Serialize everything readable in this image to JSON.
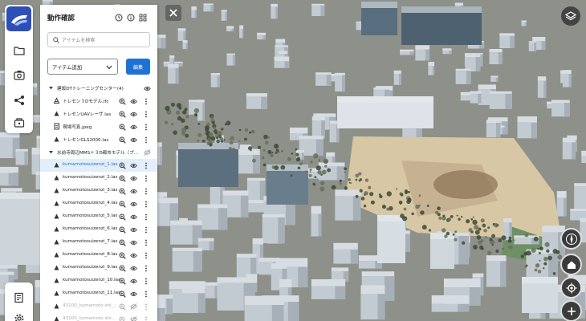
{
  "panel": {
    "title": "動作確認",
    "search_placeholder": "アイテムを検索",
    "select_value": "アイテム追加",
    "edit_label": "編集"
  },
  "tree": [
    {
      "label": "建設DTトレーニングセンター(4)",
      "level": 0,
      "type": "folder",
      "eye": true
    },
    {
      "label": "トレセン３Dモデル.ifc",
      "level": 1,
      "type": "model"
    },
    {
      "label": "トレセンUAVレーザ.las",
      "level": 1,
      "type": "points"
    },
    {
      "label": "現場写真.jpeg",
      "level": 1,
      "type": "doc"
    },
    {
      "label": "トレセンGLS2000.las",
      "level": 1,
      "type": "points"
    },
    {
      "label": "水前寺周辺MMS＋３D都市モデル（プ...",
      "level": 0,
      "type": "folder",
      "eye": false
    },
    {
      "label": "kumamotosuizenzi_1.las",
      "level": 1,
      "type": "points",
      "selected": true
    },
    {
      "label": "kumamotosuizenzi_2.las",
      "level": 1,
      "type": "points"
    },
    {
      "label": "kumamotosuizenzi_3.las",
      "level": 1,
      "type": "points"
    },
    {
      "label": "kumamotosuizenzi_4.las",
      "level": 1,
      "type": "points"
    },
    {
      "label": "kumamotosuizenzi_5.las",
      "level": 1,
      "type": "points"
    },
    {
      "label": "kumamotosuizenzi_6.las",
      "level": 1,
      "type": "points"
    },
    {
      "label": "kumamotosuizenzi_7.las",
      "level": 1,
      "type": "points"
    },
    {
      "label": "kumamotosuizenzi_8.las",
      "level": 1,
      "type": "points"
    },
    {
      "label": "kumamotosuizenzi_9.las",
      "level": 1,
      "type": "points"
    },
    {
      "label": "kumamotosuizenzi_10.las",
      "level": 1,
      "type": "points"
    },
    {
      "label": "kumamotosuizenzi_11.las",
      "level": 1,
      "type": "points"
    },
    {
      "label": "43100_kumamoto-shi_...",
      "level": 1,
      "type": "points",
      "faded": true
    },
    {
      "label": "43100_kumamoto-shi...",
      "level": 1,
      "type": "points",
      "faded": true
    }
  ],
  "colors": {
    "accent": "#1e73d2",
    "selected_bg": "#e3eefb",
    "logo": "#2d4fb6"
  },
  "icons": {
    "rail": [
      "folder-icon",
      "camera-icon",
      "share-icon",
      "drive-icon"
    ],
    "head": [
      "clock-icon",
      "info-icon",
      "grid-icon"
    ],
    "map": [
      "close-icon",
      "layers-icon",
      "compass-icon",
      "home-icon",
      "locate-icon",
      "zoom-in-icon"
    ]
  }
}
